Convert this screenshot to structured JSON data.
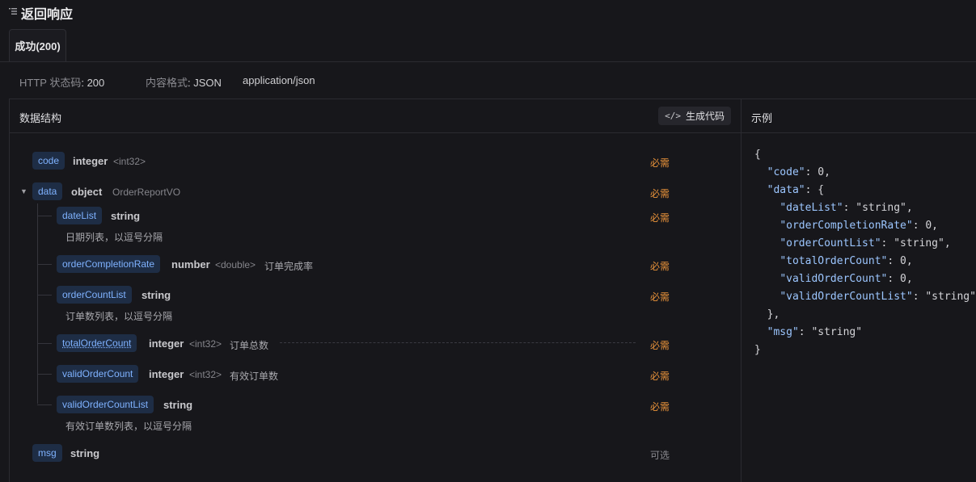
{
  "section": {
    "title": "返回响应"
  },
  "tabs": [
    {
      "label": "成功(200)"
    }
  ],
  "meta": {
    "status_key": "HTTP 状态码",
    "status_value": "200",
    "format_key": "内容格式",
    "format_value": "JSON",
    "content_type": "application/json"
  },
  "schema": {
    "title": "数据结构",
    "gen_code_label": "生成代码",
    "fields": {
      "code": {
        "name": "code",
        "type": "integer",
        "format": "<int32>",
        "required": "必需"
      },
      "data": {
        "name": "data",
        "type": "object",
        "ref": "OrderReportVO",
        "required": "必需"
      },
      "dateList": {
        "name": "dateList",
        "type": "string",
        "desc": "日期列表，以逗号分隔",
        "required": "必需"
      },
      "orderCompletionRate": {
        "name": "orderCompletionRate",
        "type": "number",
        "format": "<double>",
        "desc": "订单完成率",
        "required": "必需"
      },
      "orderCountList": {
        "name": "orderCountList",
        "type": "string",
        "desc": "订单数列表，以逗号分隔",
        "required": "必需"
      },
      "totalOrderCount": {
        "name": "totalOrderCount",
        "type": "integer",
        "format": "<int32>",
        "desc": "订单总数",
        "required": "必需"
      },
      "validOrderCount": {
        "name": "validOrderCount",
        "type": "integer",
        "format": "<int32>",
        "desc": "有效订单数",
        "required": "必需"
      },
      "validOrderCountList": {
        "name": "validOrderCountList",
        "type": "string",
        "desc": "有效订单数列表，以逗号分隔",
        "required": "必需"
      },
      "msg": {
        "name": "msg",
        "type": "string",
        "required": "可选"
      }
    }
  },
  "example": {
    "title": "示例",
    "code": "{\n  \"code\": 0,\n  \"data\": {\n    \"dateList\": \"string\",\n    \"orderCompletionRate\": 0,\n    \"orderCountList\": \"string\",\n    \"totalOrderCount\": 0,\n    \"validOrderCount\": 0,\n    \"validOrderCountList\": \"string\"\n  },\n  \"msg\": \"string\"\n}"
  },
  "icons": {
    "toc": "list-icon",
    "code": "code-icon",
    "caret": "caret-down-icon"
  }
}
